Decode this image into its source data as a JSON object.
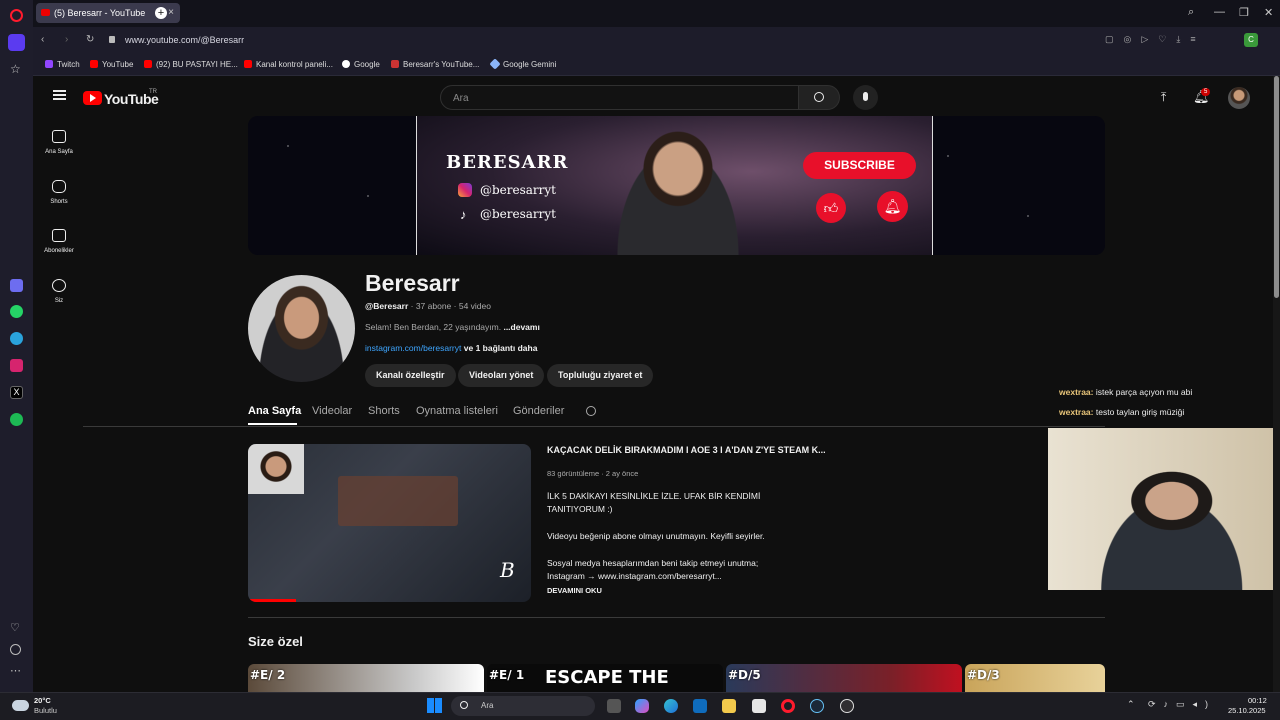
{
  "browser": {
    "tab_title": "(5) Beresarr - YouTube",
    "url": "www.youtube.com/@Beresarr",
    "bookmarks": [
      "Twitch",
      "YouTube",
      "(92) BU PASTAYI HE...",
      "Kanal kontrol paneli...",
      "Google",
      "Beresarr's YouTube...",
      "Google Gemini"
    ]
  },
  "youtube": {
    "logo": "YouTube",
    "logo_region": "TR",
    "search_placeholder": "Ara",
    "notification_count": "5",
    "nav": [
      {
        "label": "Ana Sayfa"
      },
      {
        "label": "Shorts"
      },
      {
        "label": "Abonelikler"
      },
      {
        "label": "Siz"
      }
    ],
    "banner": {
      "name": "BERESARR",
      "instagram": "@beresarryt",
      "tiktok": "@beresarryt",
      "subscribe": "SUBSCRIBE"
    },
    "channel": {
      "name": "Beresarr",
      "handle": "@Beresarr",
      "subscribers": "37 abone",
      "videos": "54 video",
      "description": "Selam! Ben Berdan, 22 yaşındayım.",
      "more": "...devamı",
      "link": "instagram.com/beresarryt",
      "link_more": "ve 1 bağlantı daha",
      "buttons": [
        "Kanalı özelleştir",
        "Videoları yönet",
        "Topluluğu ziyaret et"
      ]
    },
    "tabs": [
      "Ana Sayfa",
      "Videolar",
      "Shorts",
      "Oynatma listeleri",
      "Gönderiler"
    ],
    "featured": {
      "title": "KAÇACAK DELİK BIRAKMADIM I AOE 3 I A'DAN Z'YE STEAM K...",
      "views": "83 görüntüleme",
      "age": "2 ay önce",
      "desc1": "İLK 5 DAKİKAYI KESİNLİKLE İZLE. UFAK BİR KENDİMİ TANITIYORUM :)",
      "desc2": "Videoyu beğenip abone olmayı unutmayın. Keyifli seyirler.",
      "desc3": "Sosyal medya hesaplarımdan beni takip etmeyi unutma;",
      "desc4": "Instagram → www.instagram.com/beresarryt...",
      "read_more": "DEVAMINI OKU"
    },
    "section_title": "Size özel",
    "cards": [
      "#E/ 2",
      "#E/ 1",
      "#D/5",
      "#D/3"
    ],
    "card_title": "ESCAPE THE"
  },
  "chat": [
    {
      "user": "wextraa:",
      "msg": "istek parça açıyon mu abi"
    },
    {
      "user": "wextraa:",
      "msg": "testo taylan giriş müziği"
    }
  ],
  "taskbar": {
    "weather_temp": "20°C",
    "weather_desc": "Bulutlu",
    "search": "Ara",
    "time": "00:12",
    "date": "25.10.2025"
  },
  "colors": {
    "yt_red": "#ff0000",
    "link_blue": "#3ea6ff",
    "accent": "#e8102a"
  }
}
